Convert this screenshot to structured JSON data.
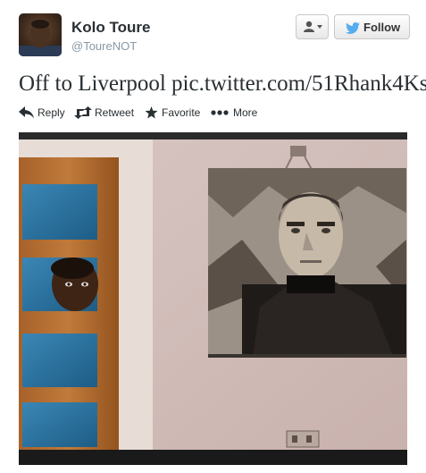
{
  "user": {
    "name": "Kolo Toure",
    "handle": "@ToureNOT"
  },
  "follow_button": {
    "label": "Follow"
  },
  "tweet": {
    "text": "Off to Liverpool",
    "link": "pic.twitter.com/51Rhank4Ks"
  },
  "actions": [
    {
      "label": "Reply",
      "icon": "reply-icon"
    },
    {
      "label": "Retweet",
      "icon": "retweet-icon"
    },
    {
      "label": "Favorite",
      "icon": "star-icon"
    },
    {
      "label": "More",
      "icon": "ellipsis-icon"
    }
  ],
  "colors": {
    "text": "#292f33",
    "secondary": "#8899a6",
    "twitter_blue": "#55acee"
  }
}
